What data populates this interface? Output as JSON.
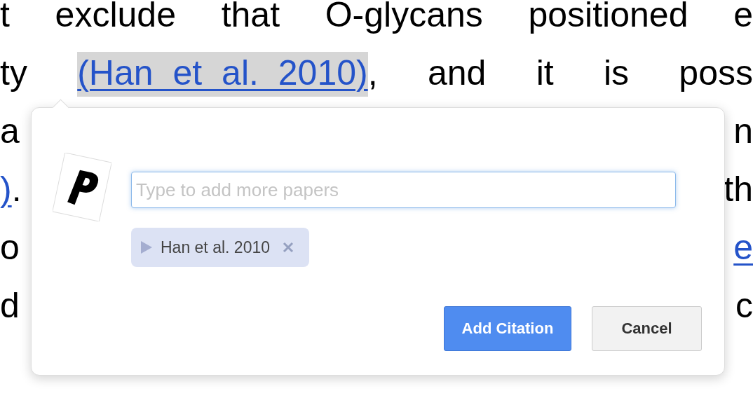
{
  "document": {
    "lines": [
      {
        "segments": [
          {
            "kind": "text",
            "text": "t"
          },
          {
            "kind": "text",
            "text": "exclude"
          },
          {
            "kind": "text",
            "text": "that"
          },
          {
            "kind": "text",
            "text": "O-glycans"
          },
          {
            "kind": "text",
            "text": "positioned"
          },
          {
            "kind": "text",
            "text": "e"
          }
        ]
      },
      {
        "segments": [
          {
            "kind": "text",
            "text": "ty"
          },
          {
            "kind": "link",
            "text": "(Han et al. 2010)",
            "highlighted": true
          },
          {
            "kind": "attached",
            "text": ","
          },
          {
            "kind": "text",
            "text": "and"
          },
          {
            "kind": "text",
            "text": "it"
          },
          {
            "kind": "text",
            "text": "is"
          },
          {
            "kind": "text",
            "text": "poss"
          }
        ]
      },
      {
        "segments": [
          {
            "kind": "text",
            "text": "a"
          },
          {
            "kind": "text",
            "text": "n"
          }
        ]
      },
      {
        "segments": [
          {
            "kind": "link",
            "text": ")",
            "highlighted": false
          },
          {
            "kind": "attached",
            "text": "."
          },
          {
            "kind": "text",
            "text": "th"
          }
        ]
      },
      {
        "segments": [
          {
            "kind": "text",
            "text": "o"
          },
          {
            "kind": "link",
            "text": "e",
            "highlighted": false
          }
        ]
      },
      {
        "segments": [
          {
            "kind": "text",
            "text": "d"
          },
          {
            "kind": "text",
            "text": "c"
          }
        ]
      }
    ]
  },
  "citation_popup": {
    "search": {
      "placeholder": "Type to add more papers"
    },
    "chips": [
      {
        "label": "Han et al. 2010"
      }
    ],
    "buttons": [
      {
        "label": "Add Citation",
        "kind": "primary"
      },
      {
        "label": "Cancel",
        "kind": "secondary"
      }
    ]
  }
}
